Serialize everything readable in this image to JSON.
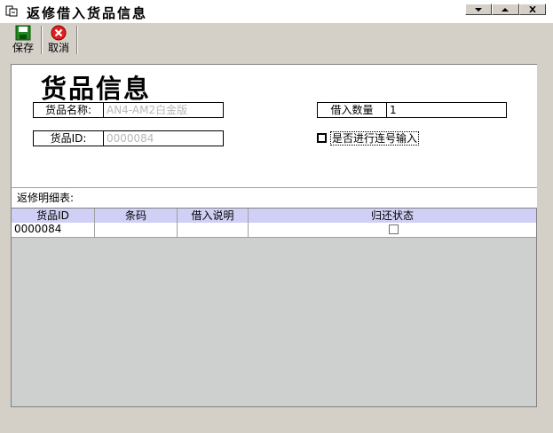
{
  "window": {
    "title": "返修借入货品信息",
    "controls": [
      "minimize-icon",
      "restore-icon",
      "close-icon"
    ]
  },
  "toolbar": {
    "save_label": "保存",
    "cancel_label": "取消",
    "save_icon": "floppy-disk-icon",
    "cancel_icon": "red-x-icon"
  },
  "form": {
    "heading": "货品信息",
    "product_name_label": "货品名称:",
    "product_name_value": "AN4-AM2白金版",
    "product_id_label": "货品ID:",
    "product_id_value": "0000084",
    "borrow_qty_label": "借入数量",
    "borrow_qty_value": "1",
    "serial_checkbox_label": "是否进行连号输入",
    "serial_checkbox_checked": false
  },
  "detail": {
    "header_label": "返修明细表:",
    "columns": [
      "货品ID",
      "条码",
      "借入说明",
      "归还状态"
    ],
    "rows": [
      {
        "product_id": "0000084",
        "barcode": "",
        "borrow_note": "",
        "returned": false
      }
    ]
  },
  "colors": {
    "grid_header_bg": "#d0d0f6",
    "grid_empty_bg": "#ced0d0",
    "window_bg": "#d4d0c8"
  }
}
